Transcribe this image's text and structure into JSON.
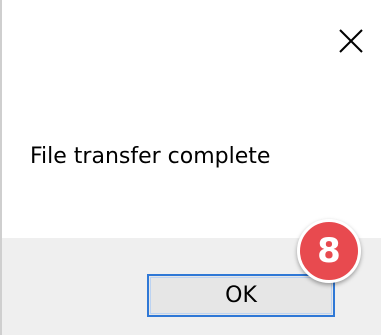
{
  "dialog": {
    "message": "File transfer complete",
    "ok_label": "OK",
    "close_icon": "close-icon"
  },
  "annotation": {
    "step_number": "8",
    "badge_color": "#e84a4f"
  },
  "colors": {
    "footer_bg": "#efefef",
    "button_border": "#2f78d6",
    "button_bg": "#e6e6e6"
  }
}
